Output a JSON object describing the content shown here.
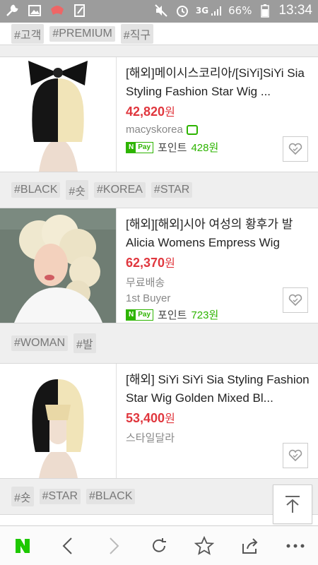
{
  "status": {
    "network": "3G",
    "battery": "66%",
    "time": "13:34"
  },
  "tags_top": [
    "#고객",
    "#PREMIUM",
    "#직구"
  ],
  "products": [
    {
      "title": "[해외]메이시스코리아/[SiYi]SiYi Sia Styling Fashion Star Wig ...",
      "price": "42,820",
      "won": "원",
      "seller": "macyskorea",
      "npay_n": "N",
      "npay_p": "Pay",
      "points_label": "포인트",
      "points": "428원",
      "tags": [
        "#BLACK",
        "#숏",
        "#KOREA",
        "#STAR"
      ]
    },
    {
      "title": "[해외][해외]시아 여성의 황후가 발 Alicia Womens Empress Wig",
      "price": "62,370",
      "won": "원",
      "shipping": "무료배송",
      "seller": "1st Buyer",
      "npay_n": "N",
      "npay_p": "Pay",
      "points_label": "포인트",
      "points": "723원",
      "tags": [
        "#WOMAN",
        "#발"
      ]
    },
    {
      "title": "[해외] SiYi SiYi Sia Styling Fashion Star Wig Golden Mixed Bl...",
      "price": "53,400",
      "won": "원",
      "seller": "스타일달라",
      "tags": [
        "#숏",
        "#STAR",
        "#BLACK"
      ]
    }
  ],
  "colors": {
    "price": "#e0373e",
    "naver_green": "#2db400"
  },
  "toolbar": [
    "naver-home",
    "back",
    "forward",
    "refresh",
    "bookmark",
    "share",
    "more"
  ]
}
